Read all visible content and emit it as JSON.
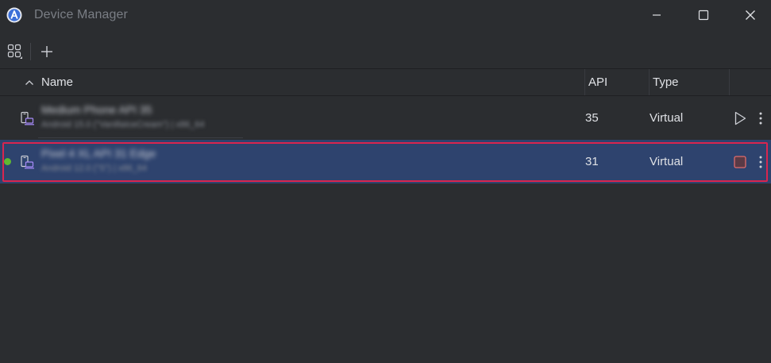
{
  "window": {
    "title": "Device Manager"
  },
  "toolbar": {
    "group_icon": "group-by-icon",
    "add_icon": "add-icon"
  },
  "table": {
    "columns": [
      {
        "label": "Name",
        "sort": "ascending"
      },
      {
        "label": "API"
      },
      {
        "label": "Type"
      }
    ],
    "rows": [
      {
        "name": "Medium Phone API 35",
        "subtitle": "Android 15.0 (\"VanillaIceCream\") | x86_64",
        "api": "35",
        "type": "Virtual",
        "running": false,
        "selected": false,
        "action_icon": "play-icon"
      },
      {
        "name": "Pixel 4 XL API 31 Edge",
        "subtitle": "Android 12.0 (\"S\") | x86_64",
        "api": "31",
        "type": "Virtual",
        "running": true,
        "selected": true,
        "action_icon": "stop-icon"
      }
    ]
  },
  "colors": {
    "background": "#2b2d30",
    "selection": "#2e436e",
    "highlight_outline": "#d9254f",
    "running_dot": "#5fb832",
    "device_icon_accent": "#a78bfa",
    "stop_icon": "#e06c6c"
  }
}
